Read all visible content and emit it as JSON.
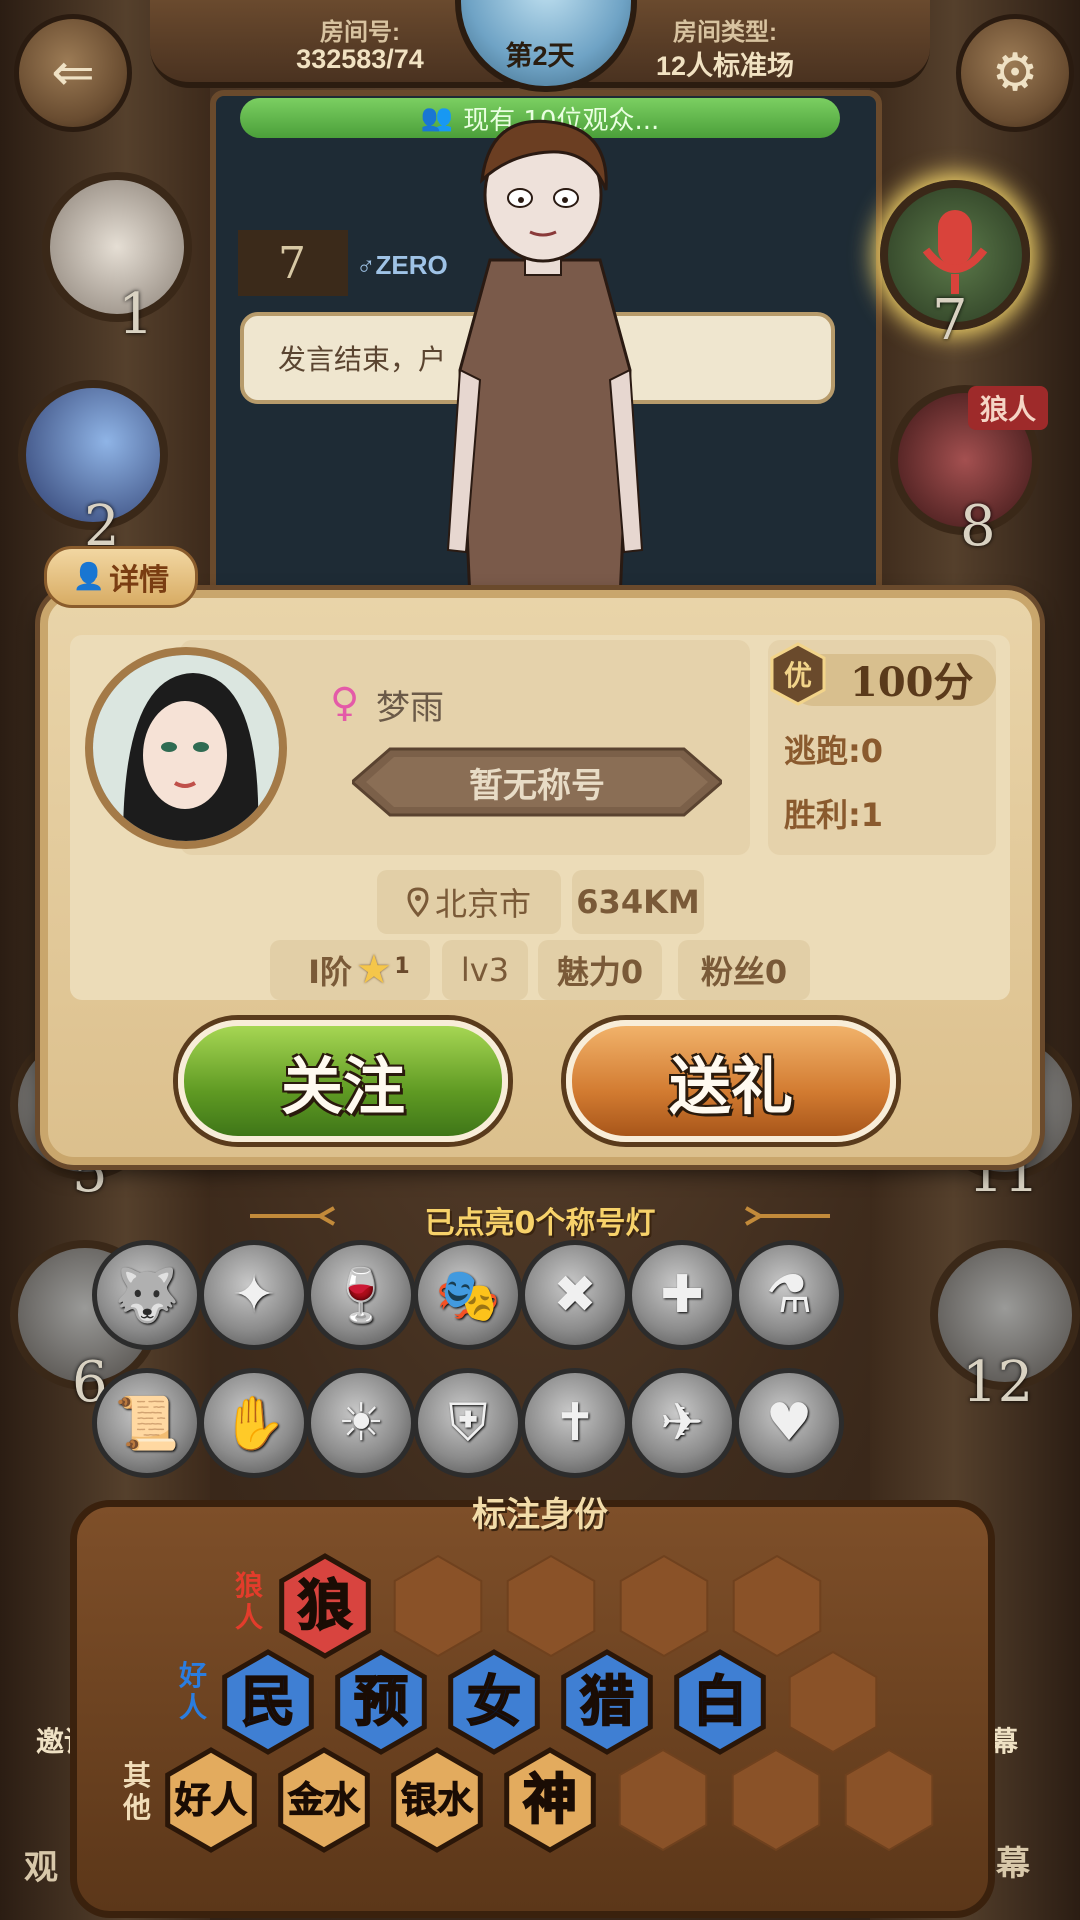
{
  "top_bar": {
    "room_no_label": "房间号:",
    "room_no": "332583/74",
    "day": "第2天",
    "room_type_label": "房间类型:",
    "room_type": "12人标准场"
  },
  "chat": {
    "viewers": "现有 10位观众...",
    "speaker_num": "7",
    "speaker_name": "♂ZERO",
    "bubble": "发言结束，户"
  },
  "seats": {
    "s1": "1",
    "s2": "2",
    "s5": "5",
    "s6": "6",
    "s7": "7",
    "s8": "8",
    "s11": "11",
    "s12": "12",
    "wolf_tag": "狼人",
    "partial_left": "邀请",
    "partial_right": "幕",
    "partial_bottom_left": "观",
    "partial_bottom_right": "幕"
  },
  "profile": {
    "detail_tab": "详情",
    "gender_icon": "♀",
    "username": "梦雨",
    "title": "暂无称号",
    "score_icon_text": "优",
    "score": "100分",
    "escape": "逃跑:0",
    "wins": "胜利:1",
    "location": "北京市",
    "distance": "634KM",
    "rank": "I阶",
    "rank_star": "1",
    "level": "lv3",
    "charm": "魅力0",
    "fans": "粉丝0",
    "follow_label": "关注",
    "gift_label": "送礼"
  },
  "title_lights": {
    "label": "已点亮0个称号灯",
    "icons": [
      "wolf-head-icon",
      "werewolf-icon",
      "poison-cup-icon",
      "jester-mask-icon",
      "claw-icon",
      "crossbow-icon",
      "potion-bottles-icon",
      "scroll-icon",
      "gauntlet-icon",
      "sun-shield-icon",
      "holy-shield-icon",
      "tombstone-icon",
      "crow-icon",
      "lovers-icon"
    ]
  },
  "identity": {
    "header": "标注身份",
    "wolf_row_label": "狼人",
    "good_row_label": "好人",
    "other_row_label": "其他",
    "wolf": [
      "狼"
    ],
    "good": [
      "民",
      "预",
      "女",
      "猎",
      "白"
    ],
    "other": [
      "好人",
      "金水",
      "银水",
      "神"
    ],
    "colors": {
      "wolf": "#d8443f",
      "good": "#3f7fd3",
      "other": "#e3ab5e",
      "empty": "#8a5228"
    }
  }
}
